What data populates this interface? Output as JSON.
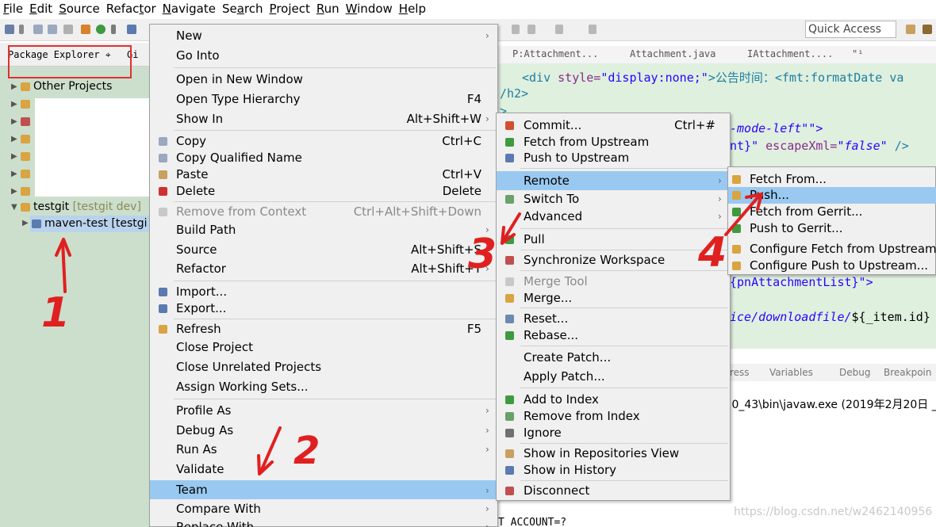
{
  "menubar": {
    "items": [
      {
        "label": "File",
        "mnemonic": "F",
        "rest": "ile"
      },
      {
        "label": "Edit",
        "mnemonic": "E",
        "rest": "dit"
      },
      {
        "label": "Source",
        "mnemonic": "S",
        "rest": "ource"
      },
      {
        "label": "Refactor",
        "pre": "Refac",
        "mnemonic": "t",
        "rest": "or"
      },
      {
        "label": "Navigate",
        "mnemonic": "N",
        "rest": "avigate"
      },
      {
        "label": "Search",
        "pre": "Se",
        "mnemonic": "a",
        "rest": "rch"
      },
      {
        "label": "Project",
        "mnemonic": "P",
        "rest": "roject"
      },
      {
        "label": "Run",
        "mnemonic": "R",
        "rest": "un"
      },
      {
        "label": "Window",
        "mnemonic": "W",
        "rest": "indow"
      },
      {
        "label": "Help",
        "mnemonic": "H",
        "rest": "elp"
      }
    ]
  },
  "toolbar": {
    "quick_access": "Quick Access"
  },
  "package_explorer": {
    "tab_label": "Package Explorer ⌖",
    "git_tab": "Gi",
    "tree": [
      {
        "label": "Other Projects",
        "extra": ""
      },
      {
        "label": "",
        "extra": ""
      },
      {
        "label": "",
        "extra": ""
      },
      {
        "label": "",
        "extra": ""
      },
      {
        "label": "",
        "extra": ""
      },
      {
        "label": "",
        "extra": ""
      },
      {
        "label": "",
        "extra": ""
      },
      {
        "label": "testgit",
        "extra": "[testgit dev]"
      },
      {
        "label": "maven-test",
        "extra": "[testgi"
      }
    ]
  },
  "editor": {
    "tabs": [
      "P:Attachment...",
      "Attachment.java",
      "IAttachment....",
      "\"¹"
    ],
    "code": {
      "l1_div": "<div ",
      "l1_attr": "style=",
      "l1_val": "\"display:none;\"",
      "l1_text": ">公告时间：",
      "l1_tag2": "<fmt:formatDate va",
      "l2": "/h2>",
      "l3": ">",
      "l4": "-mode-left\"\">",
      "l5a": "nt}\"",
      "l5b": " escapeXml=",
      "l5c": "\"false\"",
      "l5d": " />",
      "l6": "{pnAttachmentList}\">",
      "l7a": "ice/downloadfile/",
      "l7b": "${_item.id}"
    }
  },
  "console": {
    "tabs": [
      "ress",
      "Variables",
      "Debug",
      "Breakpoin"
    ],
    "line": ".0_43\\bin\\javaw.exe (2019年2月20日 _"
  },
  "bottom_code": "T_ACCOUNT=?",
  "watermark": "https://blog.csdn.net/w2462140956",
  "menu1": {
    "items": [
      {
        "label": "New",
        "accel": "",
        "sub": true
      },
      {
        "label": "Go Into",
        "accel": "",
        "sub": false
      },
      {
        "label": "Open in New Window",
        "accel": "",
        "sub": false
      },
      {
        "label": "Open Type Hierarchy",
        "accel": "F4",
        "sub": false
      },
      {
        "label": "Show In",
        "accel": "Alt+Shift+W",
        "sub": true
      },
      {
        "label": "Copy",
        "accel": "Ctrl+C",
        "sub": false
      },
      {
        "label": "Copy Qualified Name",
        "accel": "",
        "sub": false
      },
      {
        "label": "Paste",
        "accel": "Ctrl+V",
        "sub": false
      },
      {
        "label": "Delete",
        "accel": "Delete",
        "sub": false
      },
      {
        "label": "Remove from Context",
        "accel": "Ctrl+Alt+Shift+Down",
        "sub": false
      },
      {
        "label": "Build Path",
        "accel": "",
        "sub": true
      },
      {
        "label": "Source",
        "accel": "Alt+Shift+S",
        "sub": true
      },
      {
        "label": "Refactor",
        "accel": "Alt+Shift+T",
        "sub": true
      },
      {
        "label": "Import...",
        "accel": "",
        "sub": false
      },
      {
        "label": "Export...",
        "accel": "",
        "sub": false
      },
      {
        "label": "Refresh",
        "accel": "F5",
        "sub": false
      },
      {
        "label": "Close Project",
        "accel": "",
        "sub": false
      },
      {
        "label": "Close Unrelated Projects",
        "accel": "",
        "sub": false
      },
      {
        "label": "Assign Working Sets...",
        "accel": "",
        "sub": false
      },
      {
        "label": "Profile As",
        "accel": "",
        "sub": true
      },
      {
        "label": "Debug As",
        "accel": "",
        "sub": true
      },
      {
        "label": "Run As",
        "accel": "",
        "sub": true
      },
      {
        "label": "Validate",
        "accel": "",
        "sub": false
      },
      {
        "label": "Team",
        "accel": "",
        "sub": true
      },
      {
        "label": "Compare With",
        "accel": "",
        "sub": true
      },
      {
        "label": "Replace With",
        "accel": "",
        "sub": true
      }
    ]
  },
  "menu2": {
    "items": [
      {
        "label": "Commit...",
        "accel": "Ctrl+#",
        "sub": false
      },
      {
        "label": "Fetch from Upstream",
        "accel": "",
        "sub": false
      },
      {
        "label": "Push to Upstream",
        "accel": "",
        "sub": false
      },
      {
        "label": "Remote",
        "accel": "",
        "sub": true
      },
      {
        "label": "Switch To",
        "accel": "",
        "sub": true
      },
      {
        "label": "Advanced",
        "accel": "",
        "sub": true
      },
      {
        "label": "Pull",
        "accel": "",
        "sub": false
      },
      {
        "label": "Synchronize Workspace",
        "accel": "",
        "sub": false
      },
      {
        "label": "Merge Tool",
        "accel": "",
        "sub": false
      },
      {
        "label": "Merge...",
        "accel": "",
        "sub": false
      },
      {
        "label": "Reset...",
        "accel": "",
        "sub": false
      },
      {
        "label": "Rebase...",
        "accel": "",
        "sub": false
      },
      {
        "label": "Create Patch...",
        "accel": "",
        "sub": false
      },
      {
        "label": "Apply Patch...",
        "accel": "",
        "sub": false
      },
      {
        "label": "Add to Index",
        "accel": "",
        "sub": false
      },
      {
        "label": "Remove from Index",
        "accel": "",
        "sub": false
      },
      {
        "label": "Ignore",
        "accel": "",
        "sub": false
      },
      {
        "label": "Show in Repositories View",
        "accel": "",
        "sub": false
      },
      {
        "label": "Show in History",
        "accel": "",
        "sub": false
      },
      {
        "label": "Disconnect",
        "accel": "",
        "sub": false
      }
    ]
  },
  "menu3": {
    "items": [
      {
        "label": "Fetch From..."
      },
      {
        "label": "Push..."
      },
      {
        "label": "Fetch from Gerrit..."
      },
      {
        "label": "Push to Gerrit..."
      },
      {
        "label": "Configure Fetch from Upstream..."
      },
      {
        "label": "Configure Push to Upstream..."
      }
    ]
  },
  "annotations": {
    "n1": "1",
    "n2": "2",
    "n3": "3",
    "n4": "4"
  },
  "colors": {
    "highlight": "#99c9f0",
    "annotation": "#e02020",
    "explorer_bg": "#ccdfcc",
    "editor_bg": "#dff0df"
  }
}
